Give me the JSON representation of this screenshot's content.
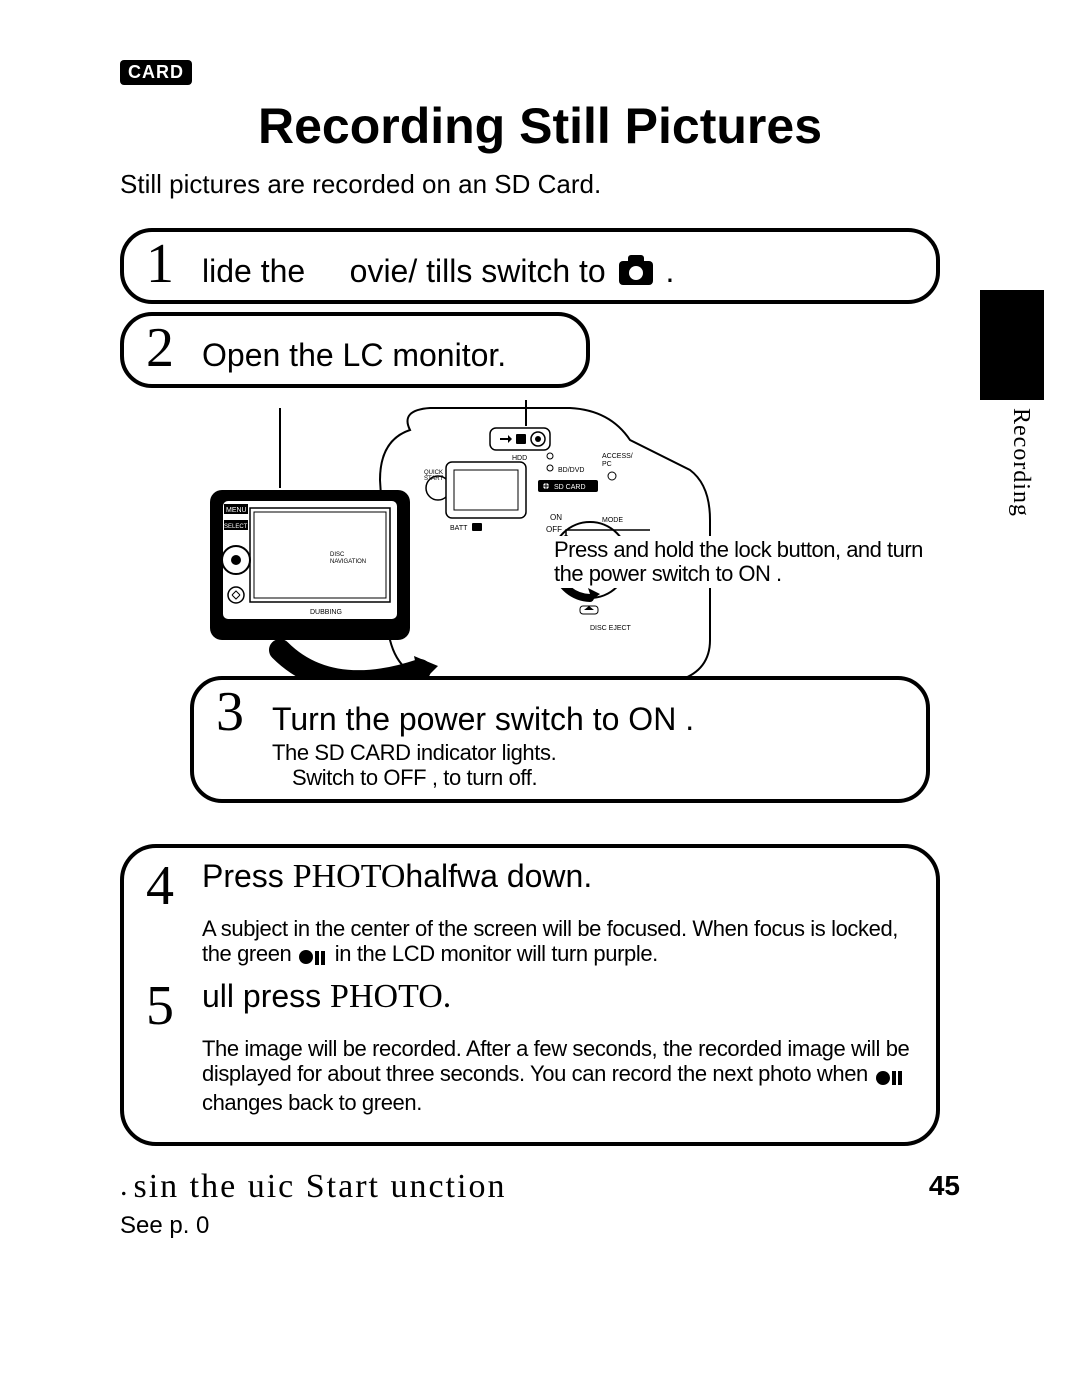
{
  "badge": "CARD",
  "title": "Recording Still Pictures",
  "intro": "Still pictures are recorded on an SD Card.",
  "side_label": "Recording",
  "steps": {
    "s1": {
      "num": "1",
      "text_a": "lide the",
      "text_b": "ovie/",
      "text_c": "tills switch to",
      "text_d": "."
    },
    "s2": {
      "num": "2",
      "text": "Open the LC   monitor."
    },
    "s3": {
      "num": "3",
      "text": "Turn the power switch to  ON .",
      "sub1": "The SD CARD indicator lights.",
      "sub2": "Switch to  OFF , to turn off."
    },
    "s4": {
      "num": "4",
      "text_a": "Press ",
      "text_photo": "PHOTO",
      "text_b": "halfwa   down.",
      "sub": "A subject in the center of the screen will be focused. When focus is locked, the green         in the LCD monitor will turn purple."
    },
    "s5": {
      "num": "5",
      "text_a": "ull  press ",
      "text_photo": "PHOTO.",
      "sub": "The image will be recorded. After a few seconds, the recorded image will be displayed for about three seconds. You can record the next photo when         changes back to green."
    }
  },
  "callout": "Press and hold the lock button, and turn the power switch to  ON .",
  "quickstart_prefix": ".",
  "quickstart": "sin  the  uic  Start  unction",
  "seep": "See p. 0",
  "page_number": "45",
  "camera_labels": {
    "menu": "MENU",
    "select": "SELECT",
    "disc_nav": "DISC NAVIGATION",
    "dubbing": "DUBBING",
    "quickstart": "QUICK START",
    "hdd": "HDD",
    "bd": "BD/DVD",
    "sd": "SD CARD",
    "access": "ACCESS PC",
    "batt": "BATT",
    "on": "ON",
    "off": "OFF",
    "mode": "MODE",
    "eject": "DISC EJECT"
  }
}
